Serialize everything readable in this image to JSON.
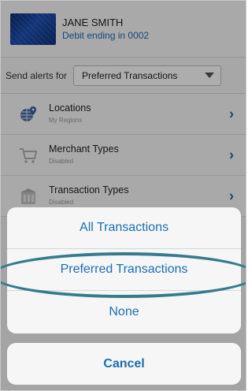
{
  "account": {
    "name": "JANE SMITH",
    "card": "Debit ending in 0002"
  },
  "alerts": {
    "label": "Send alerts for",
    "selected": "Preferred Transactions"
  },
  "list": [
    {
      "title": "Locations",
      "subtitle": "My Regions",
      "icon": "globe-pin-icon"
    },
    {
      "title": "Merchant Types",
      "subtitle": "Disabled",
      "icon": "shopping-cart-icon"
    },
    {
      "title": "Transaction Types",
      "subtitle": "Disabled",
      "icon": "building-icon"
    }
  ],
  "action_sheet": {
    "options": [
      "All Transactions",
      "Preferred Transactions",
      "None"
    ],
    "cancel": "Cancel"
  },
  "colors": {
    "accent": "#1a6fb3",
    "highlight": "#347c8c"
  }
}
